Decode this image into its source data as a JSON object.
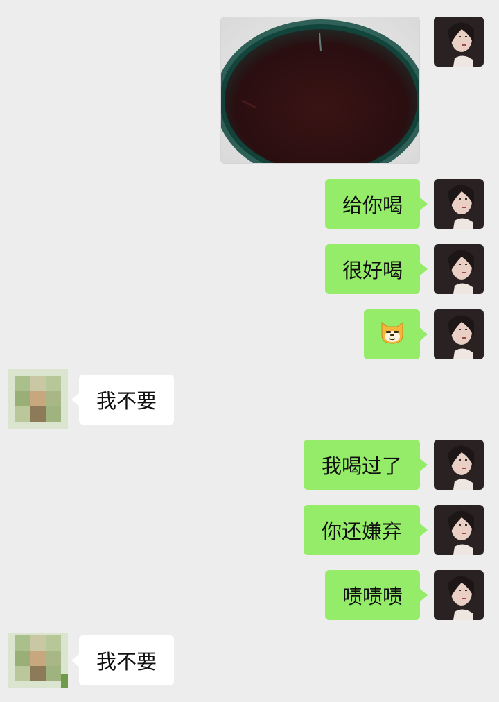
{
  "messages": [
    {
      "from": "self",
      "type": "image",
      "description_icon": "image-of-dark-drink-icon"
    },
    {
      "from": "self",
      "type": "text",
      "text": "给你喝"
    },
    {
      "from": "self",
      "type": "text",
      "text": "很好喝"
    },
    {
      "from": "self",
      "type": "emoji",
      "emoji": "🐶"
    },
    {
      "from": "other",
      "type": "text",
      "text": "我不要"
    },
    {
      "from": "self",
      "type": "text",
      "text": "我喝过了"
    },
    {
      "from": "self",
      "type": "text",
      "text": "你还嫌弃"
    },
    {
      "from": "self",
      "type": "text",
      "text": "啧啧啧"
    },
    {
      "from": "other",
      "type": "text",
      "text": "我不要"
    }
  ],
  "colors": {
    "background": "#ededed",
    "self_bubble": "#95ec69",
    "other_bubble": "#ffffff"
  }
}
